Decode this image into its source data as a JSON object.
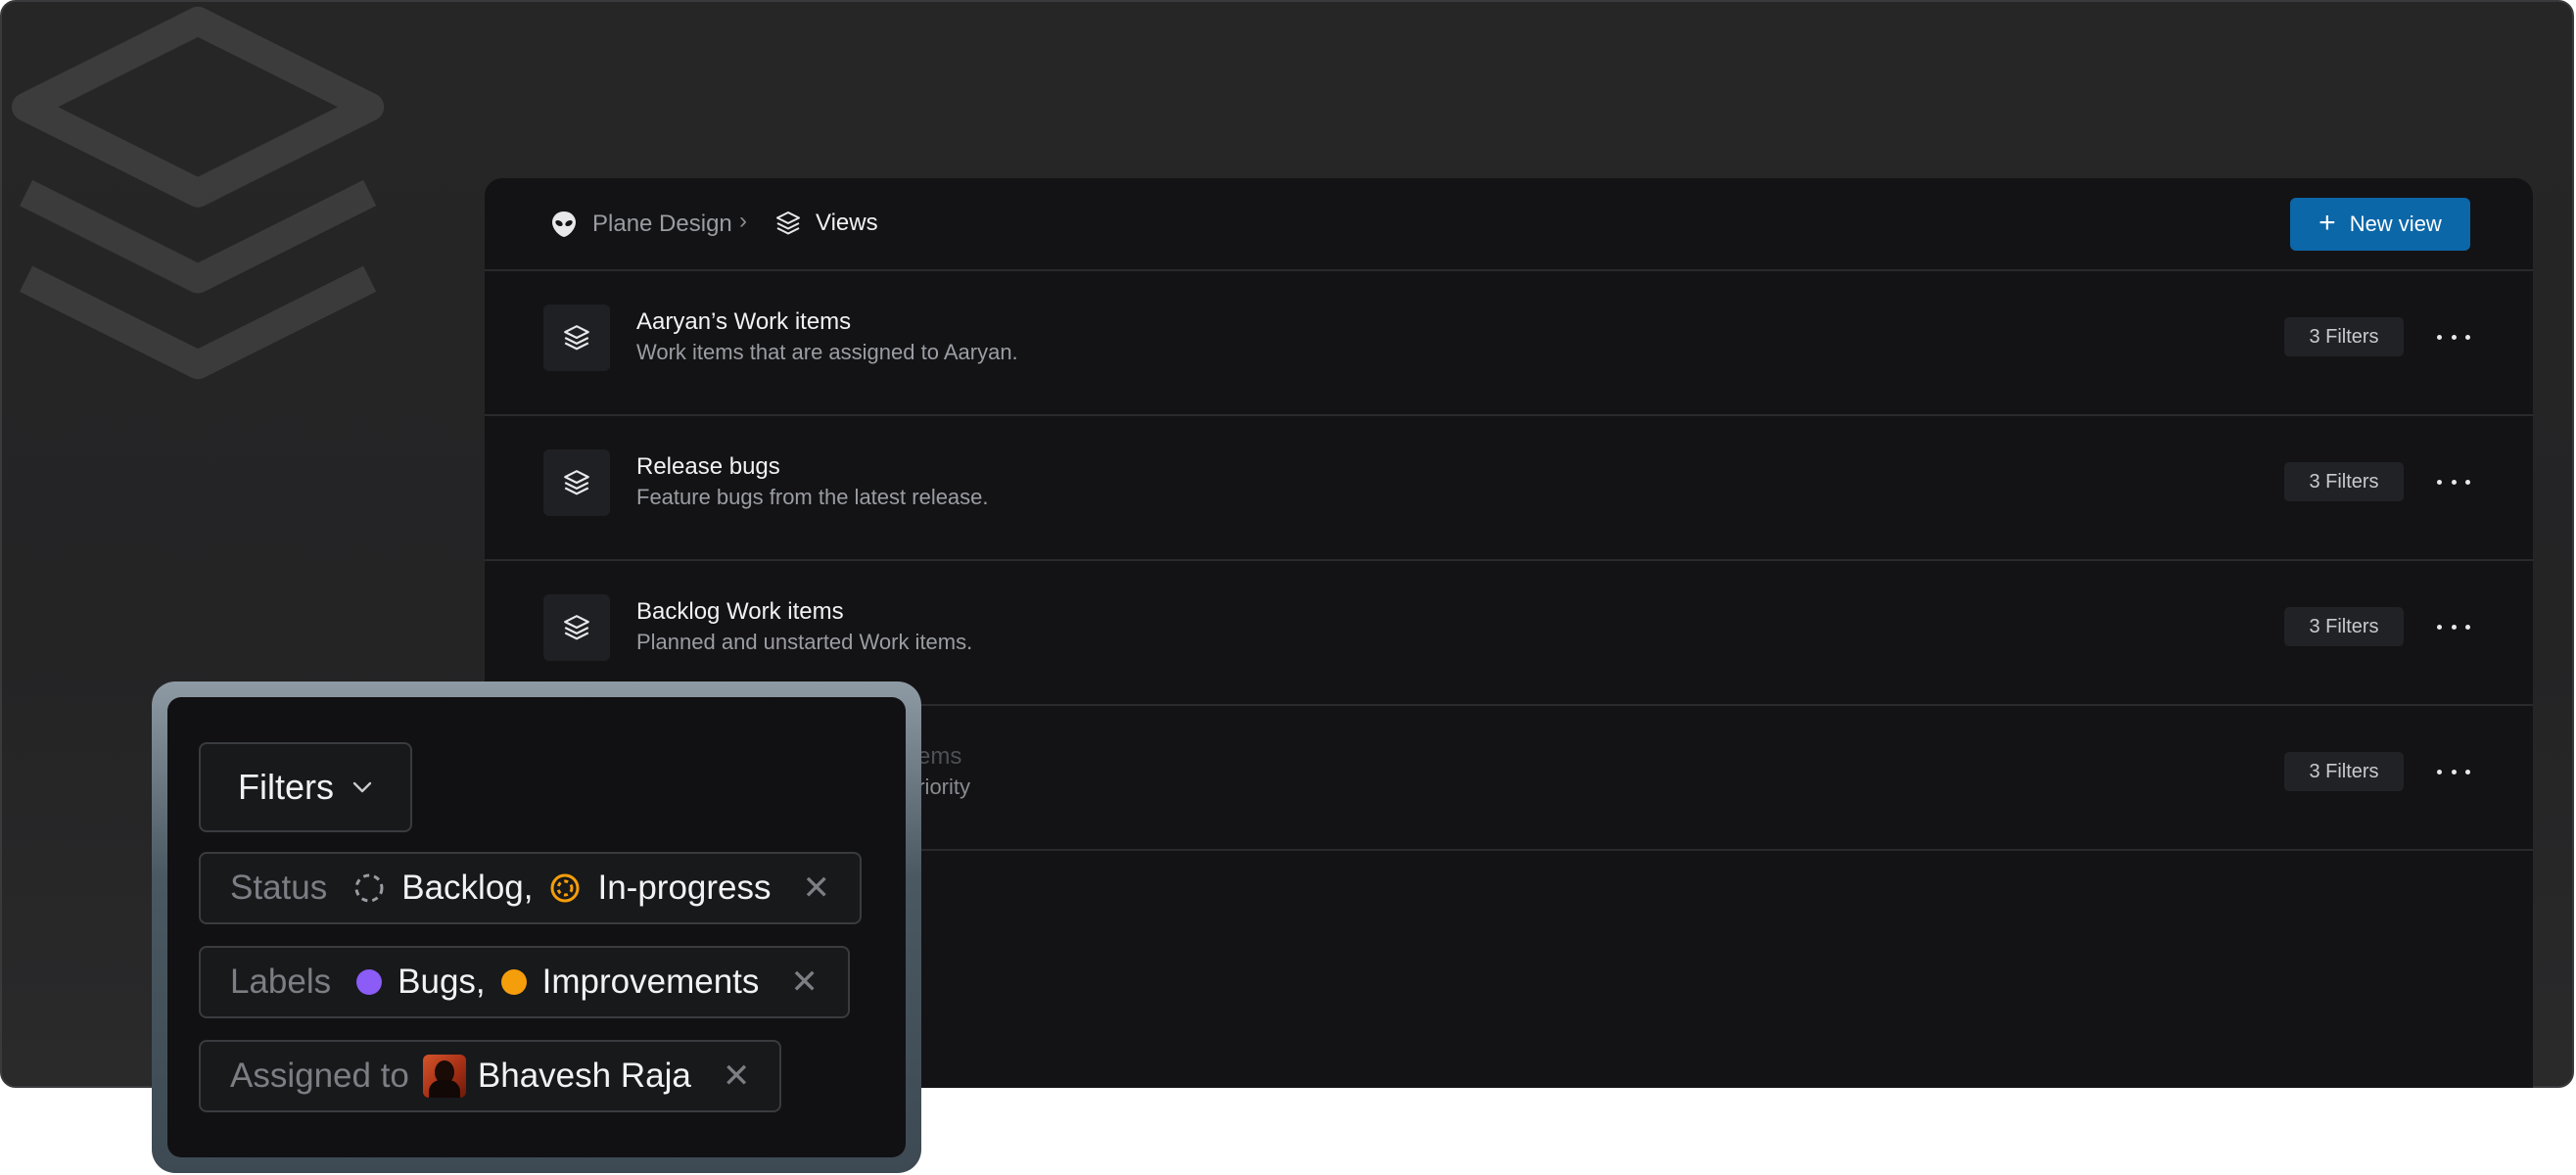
{
  "breadcrumb": {
    "workspace": "Plane Design",
    "separator": "›",
    "current": "Views"
  },
  "toolbar": {
    "new_view_label": "New view"
  },
  "views": [
    {
      "title": "Aaryan’s Work items",
      "description": "Work items that are assigned to Aaryan.",
      "filters": "3 Filters"
    },
    {
      "title": "Release bugs",
      "description": "Feature bugs from the latest release.",
      "filters": "3 Filters"
    },
    {
      "title": "Backlog Work items",
      "description": "Planned and unstarted Work items.",
      "filters": "3 Filters"
    },
    {
      "title": "items",
      "description": "priority",
      "filters": "3 Filters"
    }
  ],
  "filter_panel": {
    "dropdown_label": "Filters",
    "status": {
      "label": "Status",
      "values": [
        "Backlog,",
        "In-progress"
      ]
    },
    "labels": {
      "label": "Labels",
      "values": [
        "Bugs,",
        "Improvements"
      ]
    },
    "assigned": {
      "label": "Assigned to",
      "value": "Bhavesh Raja"
    }
  },
  "colors": {
    "accent": "#0b67a8",
    "in_progress": "#f59e0b",
    "bugs_label": "#8b5cf6",
    "improvements_label": "#f59e0b"
  }
}
